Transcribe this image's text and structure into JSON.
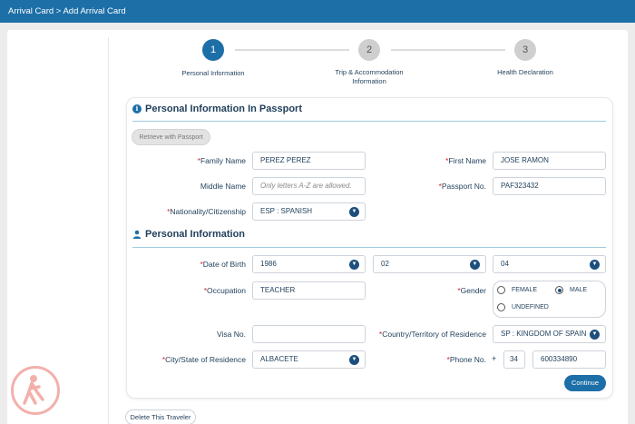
{
  "breadcrumb": {
    "text": "Arrival Card > Add Arrival Card"
  },
  "steps": [
    {
      "number": "1",
      "label": "Personal Information"
    },
    {
      "number": "2",
      "label_line1": "Trip & Accommodation",
      "label_line2": "Information"
    },
    {
      "number": "3",
      "label": "Health Declaration"
    }
  ],
  "passport_section": {
    "title": "Personal Information In Passport",
    "retrieve_button": "Retrieve with Passport",
    "family_name": {
      "label": "Family Name",
      "value": "PEREZ PEREZ"
    },
    "first_name": {
      "label": "First Name",
      "value": "JOSE RAMON"
    },
    "middle_name": {
      "label": "Middle Name",
      "placeholder": "Only letters A-Z are allowed."
    },
    "passport_no": {
      "label": "Passport No.",
      "value": "PAF323432"
    },
    "nationality": {
      "label": "Nationality/Citizenship",
      "value": "ESP : SPANISH"
    }
  },
  "personal_section": {
    "title": "Personal Information",
    "dob": {
      "label": "Date of Birth",
      "year": "1986",
      "month": "02",
      "day": "04"
    },
    "occupation": {
      "label": "Occupation",
      "value": "TEACHER"
    },
    "gender": {
      "label": "Gender",
      "options": [
        "FEMALE",
        "MALE",
        "UNDEFINED"
      ],
      "selected": "MALE"
    },
    "visa_no": {
      "label": "Visa No.",
      "value": ""
    },
    "country_residence": {
      "label": "Country/Territory of Residence",
      "value": "SP : KINGDOM OF SPAIN"
    },
    "city_residence": {
      "label": "City/State of Residence",
      "value": "ALBACETE"
    },
    "phone": {
      "label": "Phone No.",
      "plus": "+",
      "code": "34",
      "number": "600334890"
    }
  },
  "continue_button": "Continue",
  "delete_button": "Delete This Traveler",
  "colors": {
    "primary": "#1d6fa8",
    "required": "#d9252a",
    "dark_navy": "#1d4f7c"
  }
}
